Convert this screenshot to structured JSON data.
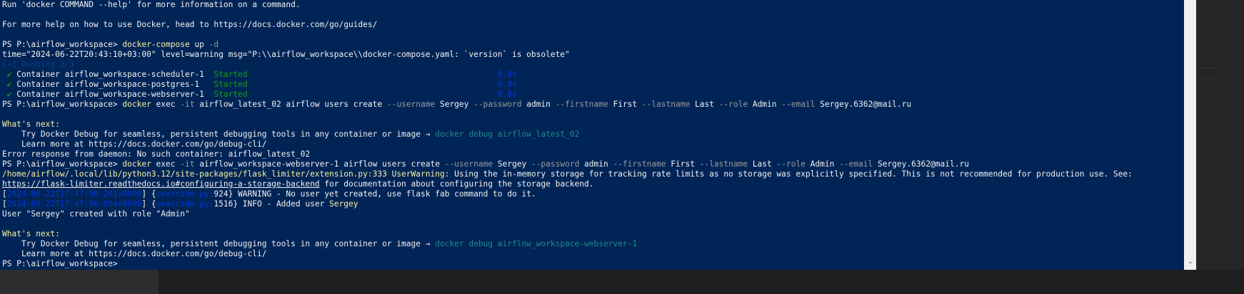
{
  "terminal": {
    "lines": [
      {
        "segs": [
          {
            "t": "Run 'docker COMMAND --help' for more information on a command.",
            "c": "w"
          }
        ]
      },
      {
        "segs": []
      },
      {
        "segs": [
          {
            "t": "For more help on how to use Docker, head to https://docs.docker.com/go/guides/",
            "c": "w"
          }
        ]
      },
      {
        "segs": []
      },
      {
        "segs": [
          {
            "t": "PS P:\\airflow_workspace> ",
            "c": "w"
          },
          {
            "t": "docker-compose",
            "c": "y"
          },
          {
            "t": " up ",
            "c": "w"
          },
          {
            "t": "-d",
            "c": "g"
          }
        ]
      },
      {
        "segs": [
          {
            "t": "time=\"2024-06-22T20:43:10+03:00\" level=warning msg=\"P:\\\\airflow_workspace\\\\docker-compose.yaml: `version` is obsolete\"",
            "c": "w"
          }
        ]
      },
      {
        "segs": [
          {
            "t": "[+] Running 3/3",
            "c": "dimc"
          }
        ]
      },
      {
        "segs": [
          {
            "t": " ✔ ",
            "c": "gr"
          },
          {
            "t": "Container airflow_workspace-scheduler-1  ",
            "c": "w"
          },
          {
            "t": "Started",
            "c": "gr"
          },
          {
            "t": "                                                    ",
            "c": "w"
          },
          {
            "t": "0.8s",
            "c": "dim"
          }
        ]
      },
      {
        "segs": [
          {
            "t": " ✔ ",
            "c": "gr"
          },
          {
            "t": "Container airflow_workspace-postgres-1   ",
            "c": "w"
          },
          {
            "t": "Started",
            "c": "gr"
          },
          {
            "t": "                                                    ",
            "c": "w"
          },
          {
            "t": "0.8s",
            "c": "dim"
          }
        ]
      },
      {
        "segs": [
          {
            "t": " ✔ ",
            "c": "gr"
          },
          {
            "t": "Container airflow_workspace-webserver-1  ",
            "c": "w"
          },
          {
            "t": "Started",
            "c": "gr"
          },
          {
            "t": "                                                    ",
            "c": "w"
          },
          {
            "t": "0.8s",
            "c": "dim"
          }
        ]
      },
      {
        "segs": [
          {
            "t": "PS P:\\airflow_workspace> ",
            "c": "w"
          },
          {
            "t": "docker",
            "c": "y"
          },
          {
            "t": " exec ",
            "c": "w"
          },
          {
            "t": "-it",
            "c": "g"
          },
          {
            "t": " airflow_latest_02 airflow users create ",
            "c": "w"
          },
          {
            "t": "--username",
            "c": "g"
          },
          {
            "t": " Sergey ",
            "c": "w"
          },
          {
            "t": "--password",
            "c": "g"
          },
          {
            "t": " admin ",
            "c": "w"
          },
          {
            "t": "--firstname",
            "c": "g"
          },
          {
            "t": " First ",
            "c": "w"
          },
          {
            "t": "--lastname",
            "c": "g"
          },
          {
            "t": " Last ",
            "c": "w"
          },
          {
            "t": "--role",
            "c": "g"
          },
          {
            "t": " Admin ",
            "c": "w"
          },
          {
            "t": "--email",
            "c": "g"
          },
          {
            "t": " Sergey.6362@mail.ru",
            "c": "w"
          }
        ]
      },
      {
        "segs": []
      },
      {
        "segs": [
          {
            "t": "What's next:",
            "c": "y"
          }
        ]
      },
      {
        "segs": [
          {
            "t": "    Try Docker Debug for seamless, persistent debugging tools in any container or image → ",
            "c": "w"
          },
          {
            "t": "docker debug airflow_latest_02",
            "c": "teal"
          }
        ]
      },
      {
        "segs": [
          {
            "t": "    Learn more at https://docs.docker.com/go/debug-cli/",
            "c": "w"
          }
        ]
      },
      {
        "segs": [
          {
            "t": "Error response from daemon: No such container: airflow_latest_02",
            "c": "w"
          }
        ]
      },
      {
        "segs": [
          {
            "t": "PS P:\\airflow_workspace> ",
            "c": "w"
          },
          {
            "t": "docker",
            "c": "y"
          },
          {
            "t": " exec ",
            "c": "w"
          },
          {
            "t": "-it",
            "c": "g"
          },
          {
            "t": " airflow_workspace-webserver-1 airflow users create ",
            "c": "w"
          },
          {
            "t": "--username",
            "c": "g"
          },
          {
            "t": " Sergey ",
            "c": "w"
          },
          {
            "t": "--password",
            "c": "g"
          },
          {
            "t": " admin ",
            "c": "w"
          },
          {
            "t": "--firstname",
            "c": "g"
          },
          {
            "t": " First ",
            "c": "w"
          },
          {
            "t": "--lastname",
            "c": "g"
          },
          {
            "t": " Last ",
            "c": "w"
          },
          {
            "t": "--role",
            "c": "g"
          },
          {
            "t": " Admin ",
            "c": "w"
          },
          {
            "t": "--email",
            "c": "g"
          },
          {
            "t": " Sergey.6362@mail.ru",
            "c": "w"
          }
        ]
      },
      {
        "segs": [
          {
            "t": "/home/airflow/.local/lib/python3.12/site-packages/flask_limiter/extension.py:333 UserWarning:",
            "c": "y"
          },
          {
            "t": " Using the in-memory storage for tracking rate limits as no storage was explicitly specified. This is not recommended for production use. See:",
            "c": "w"
          }
        ]
      },
      {
        "segs": [
          {
            "t": "https://flask-limiter.readthedocs.io#configuring-a-storage-backend",
            "c": "w u"
          },
          {
            "t": " for documentation about configuring the storage backend.",
            "c": "w"
          }
        ]
      },
      {
        "segs": [
          {
            "t": "[",
            "c": "w"
          },
          {
            "t": "2024-06-22T17:47:50.201+0000",
            "c": "dim"
          },
          {
            "t": "] {",
            "c": "w"
          },
          {
            "t": "override.py:",
            "c": "dim"
          },
          {
            "t": "924} WARNING - No user yet created, use flask fab command to do it.",
            "c": "w"
          }
        ]
      },
      {
        "segs": [
          {
            "t": "[",
            "c": "w"
          },
          {
            "t": "2024-06-22T17:47:50.854+0000",
            "c": "dim"
          },
          {
            "t": "] {",
            "c": "w"
          },
          {
            "t": "override.py:",
            "c": "dim"
          },
          {
            "t": "1516} INFO - Added user ",
            "c": "w"
          },
          {
            "t": "Sergey",
            "c": "y"
          }
        ]
      },
      {
        "segs": [
          {
            "t": "User \"Sergey\" created with role \"Admin\"",
            "c": "w"
          }
        ]
      },
      {
        "segs": []
      },
      {
        "segs": [
          {
            "t": "What's next:",
            "c": "y"
          }
        ]
      },
      {
        "segs": [
          {
            "t": "    Try Docker Debug for seamless, persistent debugging tools in any container or image → ",
            "c": "w"
          },
          {
            "t": "docker debug airflow_workspace-webserver-1",
            "c": "teal"
          }
        ]
      },
      {
        "segs": [
          {
            "t": "    Learn more at https://docs.docker.com/go/debug-cli/",
            "c": "w"
          }
        ]
      },
      {
        "segs": [
          {
            "t": "PS P:\\airflow_workspace> ",
            "c": "w"
          }
        ]
      }
    ]
  },
  "scrollbar": {
    "down_arrow": "⌄"
  },
  "colors": {
    "terminal_bg": "#012456",
    "prompt_text": "#f2f2f2",
    "command": "#f9f1a5",
    "flag": "#9a9a9a",
    "started": "#13a10e",
    "hint_link": "#1f8a8a"
  }
}
